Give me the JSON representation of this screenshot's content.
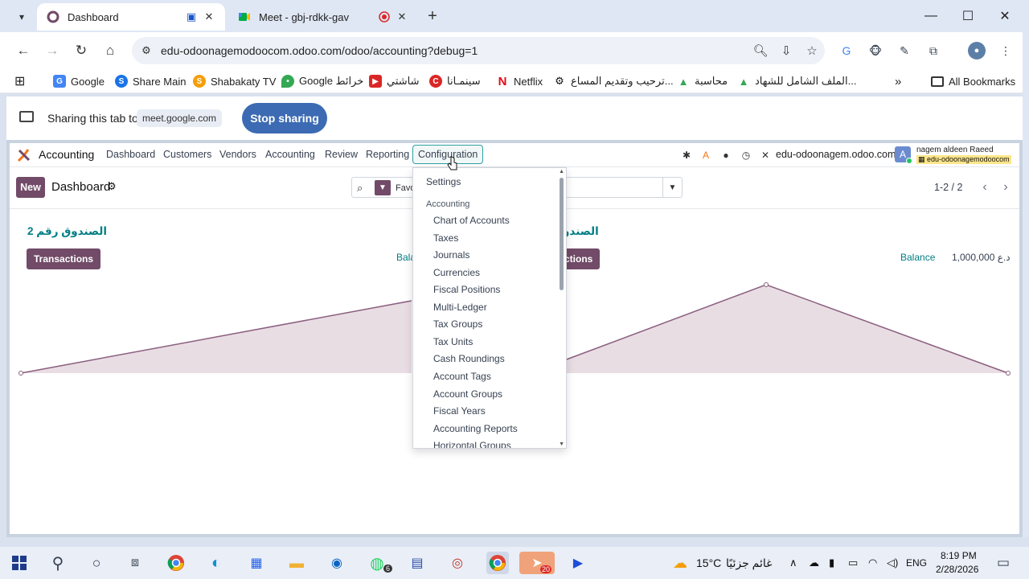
{
  "browser": {
    "tabs": [
      {
        "title": "Dashboard"
      },
      {
        "title": "Meet - gbj-rdkk-gav"
      }
    ],
    "new_tab": "+",
    "url": "edu-odoonagemodoocom.odoo.com/odoo/accounting?debug=1",
    "bookmarks": [
      {
        "label": "Google",
        "color": "#4285f4",
        "glyph": "G"
      },
      {
        "label": "Share Main",
        "color": "#1a73e8",
        "glyph": "S"
      },
      {
        "label": "Shabakaty TV",
        "color": "#f59e0b",
        "glyph": "S"
      },
      {
        "label": "Google خرائط",
        "color": "#34a853",
        "glyph": "M"
      },
      {
        "label": "شاشتي",
        "color": "#dc2626",
        "glyph": "▶"
      },
      {
        "label": "سينمـانا",
        "color": "#dc2626",
        "glyph": "C"
      },
      {
        "label": "Netflix",
        "color": "#e50914",
        "glyph": "N"
      },
      {
        "label": "ترحيب وتقديم المساع...",
        "color": "#111111",
        "glyph": "◎"
      },
      {
        "label": "محاسبة",
        "color": "#34a853",
        "glyph": "▲"
      },
      {
        "label": "الملف الشامل للشهاد...",
        "color": "#34a853",
        "glyph": "▲"
      }
    ],
    "more_bookmarks": "»",
    "all_bookmarks": "All Bookmarks"
  },
  "sharing": {
    "text": "Sharing this tab to",
    "target": "meet.google.com",
    "stop_label": "Stop sharing"
  },
  "odoo": {
    "app_name": "Accounting",
    "menu": [
      "Dashboard",
      "Customers",
      "Vendors",
      "Accounting",
      "Review",
      "Reporting",
      "Configuration"
    ],
    "db_name": "edu-odoonagem.odoo.com",
    "avatar_letter": "A",
    "user_name": "nagem aldeen Raeed",
    "user_db": "edu-odoonagemodoocom",
    "new_label": "New",
    "breadcrumb": "Dashboard",
    "search_facet": "Favo",
    "pager": "1-2 / 2",
    "cards": [
      {
        "title": "الصندوق رقم 2",
        "button": "Transactions",
        "balance_label": "Bala"
      },
      {
        "title": "الصندو",
        "button": "ctions",
        "balance_label": "Balance",
        "balance_value": "1,000,000 د.ع"
      }
    ],
    "dropdown": {
      "settings": "Settings",
      "section": "Accounting",
      "items": [
        "Chart of Accounts",
        "Taxes",
        "Journals",
        "Currencies",
        "Fiscal Positions",
        "Multi-Ledger",
        "Tax Groups",
        "Tax Units",
        "Cash Roundings",
        "Account Tags",
        "Account Groups",
        "Fiscal Years",
        "Accounting Reports",
        "Horizontal Groups"
      ]
    }
  },
  "taskbar": {
    "temperature": "15°C",
    "weather": "غائم جزئيًا",
    "lang": "ENG",
    "time": "8:19 PM",
    "date": "2/28/2026",
    "whatsapp_badge": "6",
    "telegram_badge": "20"
  },
  "colors": {
    "odoo_primary": "#714b67",
    "odoo_link": "#017e84",
    "stop_button": "#3c6bb3"
  }
}
